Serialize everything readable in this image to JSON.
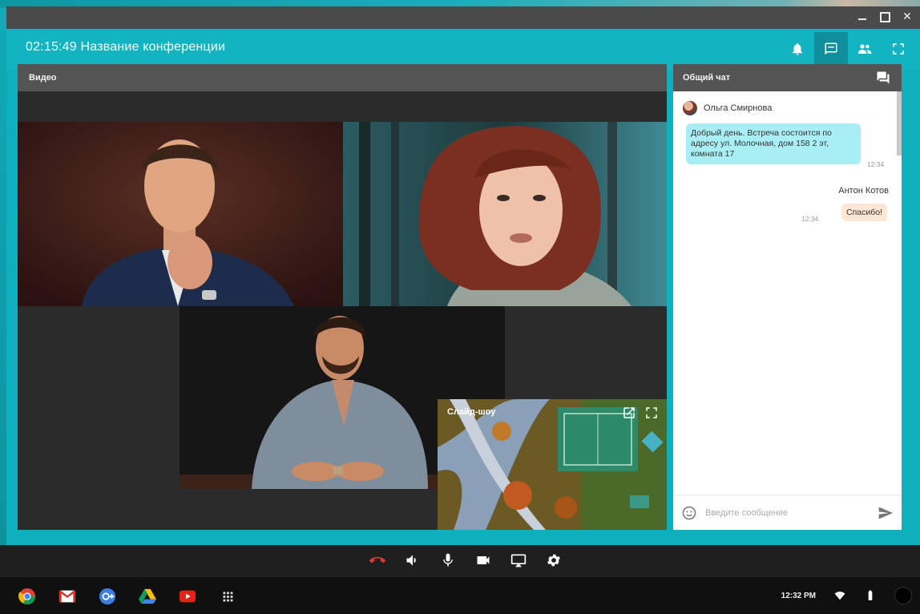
{
  "window": {
    "title_time": "02:15:49",
    "title_name": "Название конференции"
  },
  "header_icons": [
    "bell-icon",
    "chat-icon",
    "participants-icon",
    "fullscreen-icon"
  ],
  "video": {
    "panel_title": "Видео",
    "slideshow_label": "Слайд-шоу"
  },
  "chat": {
    "panel_title": "Общий чат",
    "messages": [
      {
        "author": "Ольга Смирнова",
        "text": "Добрый день. Встреча состоится по адресу ул. Молочная, дом 158 2 эт, комната 17",
        "time": "12:34"
      },
      {
        "author": "Антон Котов",
        "text": "Спасибо!",
        "time": "12:34"
      }
    ],
    "input_placeholder": "Введите сообщение"
  },
  "call_controls": [
    "hangup-icon",
    "volume-icon",
    "microphone-icon",
    "camera-icon",
    "screen-share-icon",
    "settings-icon"
  ],
  "shelf": {
    "apps": [
      "chrome-icon",
      "gmail-icon",
      "google-plus-icon",
      "drive-icon",
      "youtube-icon",
      "app-launcher-icon"
    ],
    "clock": "12:32 PM"
  },
  "colors": {
    "accent": "#13b4c1",
    "panel_header": "#545454",
    "hangup": "#e53935",
    "incoming_bubble": "#a8eef4",
    "outgoing_bubble": "#fde6d4"
  }
}
